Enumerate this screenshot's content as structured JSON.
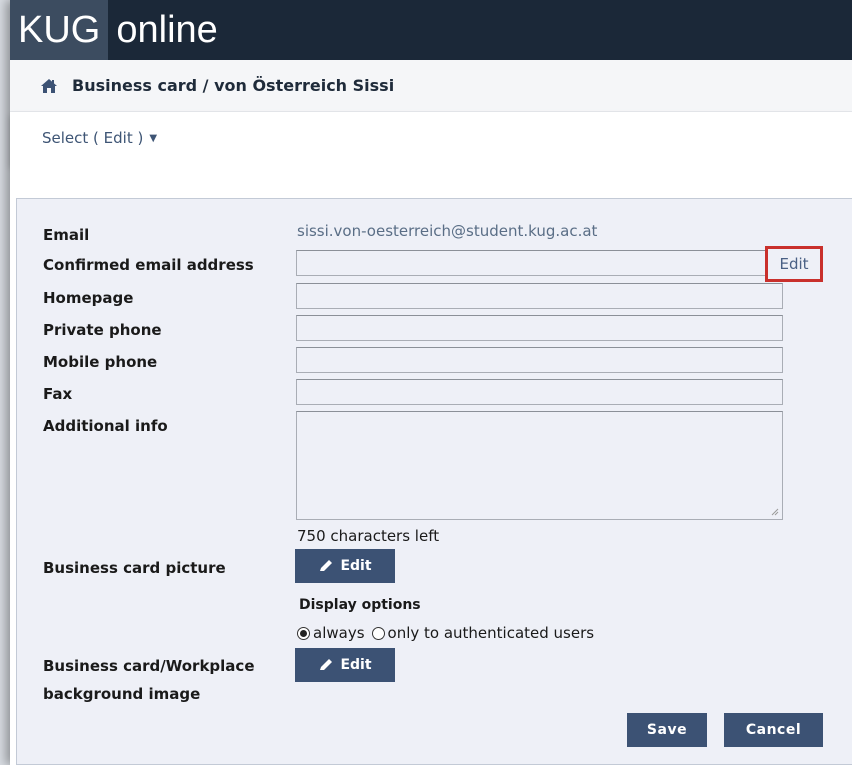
{
  "app": {
    "logo_left": "KUG",
    "logo_right": "online"
  },
  "breadcrumb": {
    "path": "Business card  / von Österreich Sissi",
    "home_icon": "home-icon"
  },
  "select_menu": {
    "label": "Select ( Edit )"
  },
  "form": {
    "email": {
      "label": "Email",
      "value": "sissi.von-oesterreich@student.kug.ac.at"
    },
    "confirmed_email": {
      "label": "Confirmed email address",
      "value": "",
      "edit_label": "Edit"
    },
    "homepage": {
      "label": "Homepage",
      "value": ""
    },
    "private_phone": {
      "label": "Private phone",
      "value": ""
    },
    "mobile_phone": {
      "label": "Mobile phone",
      "value": ""
    },
    "fax": {
      "label": "Fax",
      "value": ""
    },
    "additional_info": {
      "label": "Additional info",
      "value": "",
      "chars_left": "750 characters left"
    },
    "picture": {
      "label": "Business card picture",
      "edit_label": "Edit"
    },
    "display_options": {
      "title": "Display options",
      "options": [
        "always",
        "only to authenticated users"
      ],
      "selected": "always"
    },
    "background_image": {
      "label_line1": "Business card/Workplace",
      "label_line2": "background image",
      "edit_label": "Edit"
    },
    "save_label": "Save",
    "cancel_label": "Cancel"
  },
  "colors": {
    "header_bg": "#1b2838",
    "button_bg": "#3c5274",
    "highlight": "#c9302c",
    "panel_bg": "#eef0f7"
  }
}
